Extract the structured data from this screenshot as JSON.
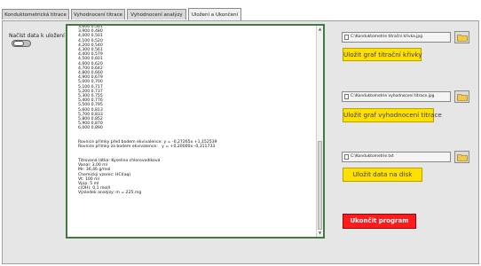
{
  "tabs": [
    {
      "label": "Konduktometrická titrace"
    },
    {
      "label": "Vyhodnocení titrace"
    },
    {
      "label": "Vyhodnocení analýzy"
    },
    {
      "label": "Uložení a Ukončení"
    }
  ],
  "active_tab_index": 3,
  "load_label": "Načíst data k uložení",
  "toggle_on": false,
  "textbox": {
    "lines": [
      "3,600 0,561",
      "3,900 0,480",
      "4,000 0,501",
      "4,100 0,520",
      "4,200 0,540",
      "4,300 0,561",
      "4,400 0,579",
      "4,500 0,601",
      "4,600 0,620",
      "4,700 0,642",
      "4,800 0,660",
      "4,900 0,679",
      "5,000 0,700",
      "5,100 0,717",
      "5,200 0,737",
      "5,300 0,755",
      "5,400 0,776",
      "5,500 0,795",
      "5,600 0,813",
      "5,700 0,833",
      "5,800 0,852",
      "5,900 0,870",
      "6,000 0,890",
      "",
      "",
      "Rovnice přímky před bodem ekvivalence: y = -0,27265x +1,152539",
      "Rovnice přímky za bodem ekvivalence:   y = +0,20000x -0,311733",
      "",
      "",
      "Titrovaná látka: Kyselina chlorovodíková",
      "Vanal: 3,00 ml",
      "Mr: 36,46 g/mol",
      "Chemický vzorec: HCl(aq)",
      "Vt: 100 ml",
      "Vpip: 5 ml",
      "c(OH): 0,1 mol/l",
      "Výsledek analýzy: m = 225 mg"
    ]
  },
  "save_sections": [
    {
      "path": "C:\\Konduktometrie titrační křivka.jpg",
      "button_label": "Uložit graf titrační křivky"
    },
    {
      "path": "C:\\Konduktometrie vyhodnocení titrace.jpg",
      "button_label": "Uložit graf vyhodnocení titrace"
    },
    {
      "path": "C:\\Konduktometrie.txt",
      "button_label": "Uložit data na disk"
    }
  ],
  "exit_button_label": "Ukončit program",
  "colors": {
    "accent_yellow": "#ffe000",
    "exit_red": "#ff1b1b",
    "textbox_border": "#3f7a3f"
  }
}
